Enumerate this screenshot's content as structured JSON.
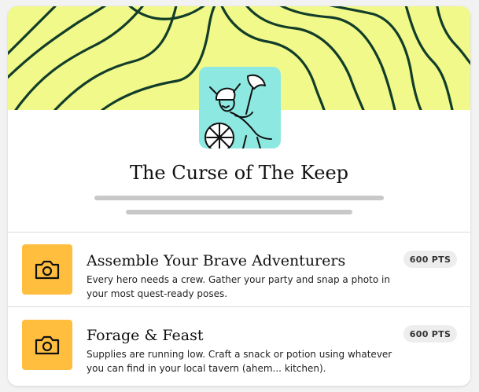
{
  "colors": {
    "banner": "#f1f98a",
    "contour": "#123d2a",
    "avatar_bg": "#8ee8e2",
    "icon_tile": "#ffbe3d",
    "badge_bg": "#ededed"
  },
  "hunt": {
    "title": "The Curse of The Keep",
    "banner_icon": "topographic-contour-pattern",
    "avatar_icon": "viking-warrior-with-axe-and-shield"
  },
  "quests": [
    {
      "title": "Assemble Your Brave Adventurers",
      "description": "Every hero needs a crew. Gather your party and snap a photo in your most quest-ready poses.",
      "points": "600 PTS",
      "icon": "camera-icon"
    },
    {
      "title": "Forage & Feast",
      "description": "Supplies are running low. Craft a snack or potion using whatever you can find in your local tavern (ahem... kitchen).",
      "points": "600 PTS",
      "icon": "camera-icon"
    }
  ]
}
